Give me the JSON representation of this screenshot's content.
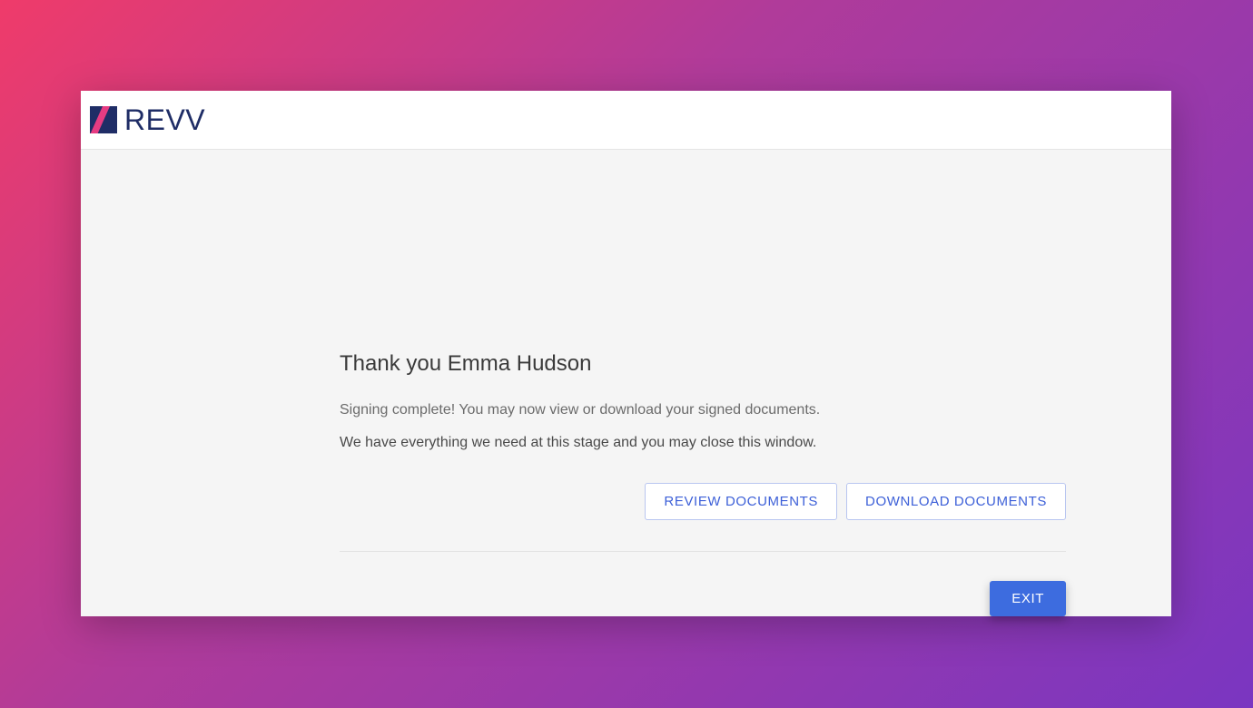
{
  "logo": {
    "text": "REVV"
  },
  "message": {
    "title": "Thank you Emma Hudson",
    "line1": "Signing complete! You may now view or download your signed documents.",
    "line2": "We have everything we need at this stage and you may close this window."
  },
  "buttons": {
    "review": "REVIEW DOCUMENTS",
    "download": "DOWNLOAD DOCUMENTS",
    "exit": "EXIT"
  }
}
